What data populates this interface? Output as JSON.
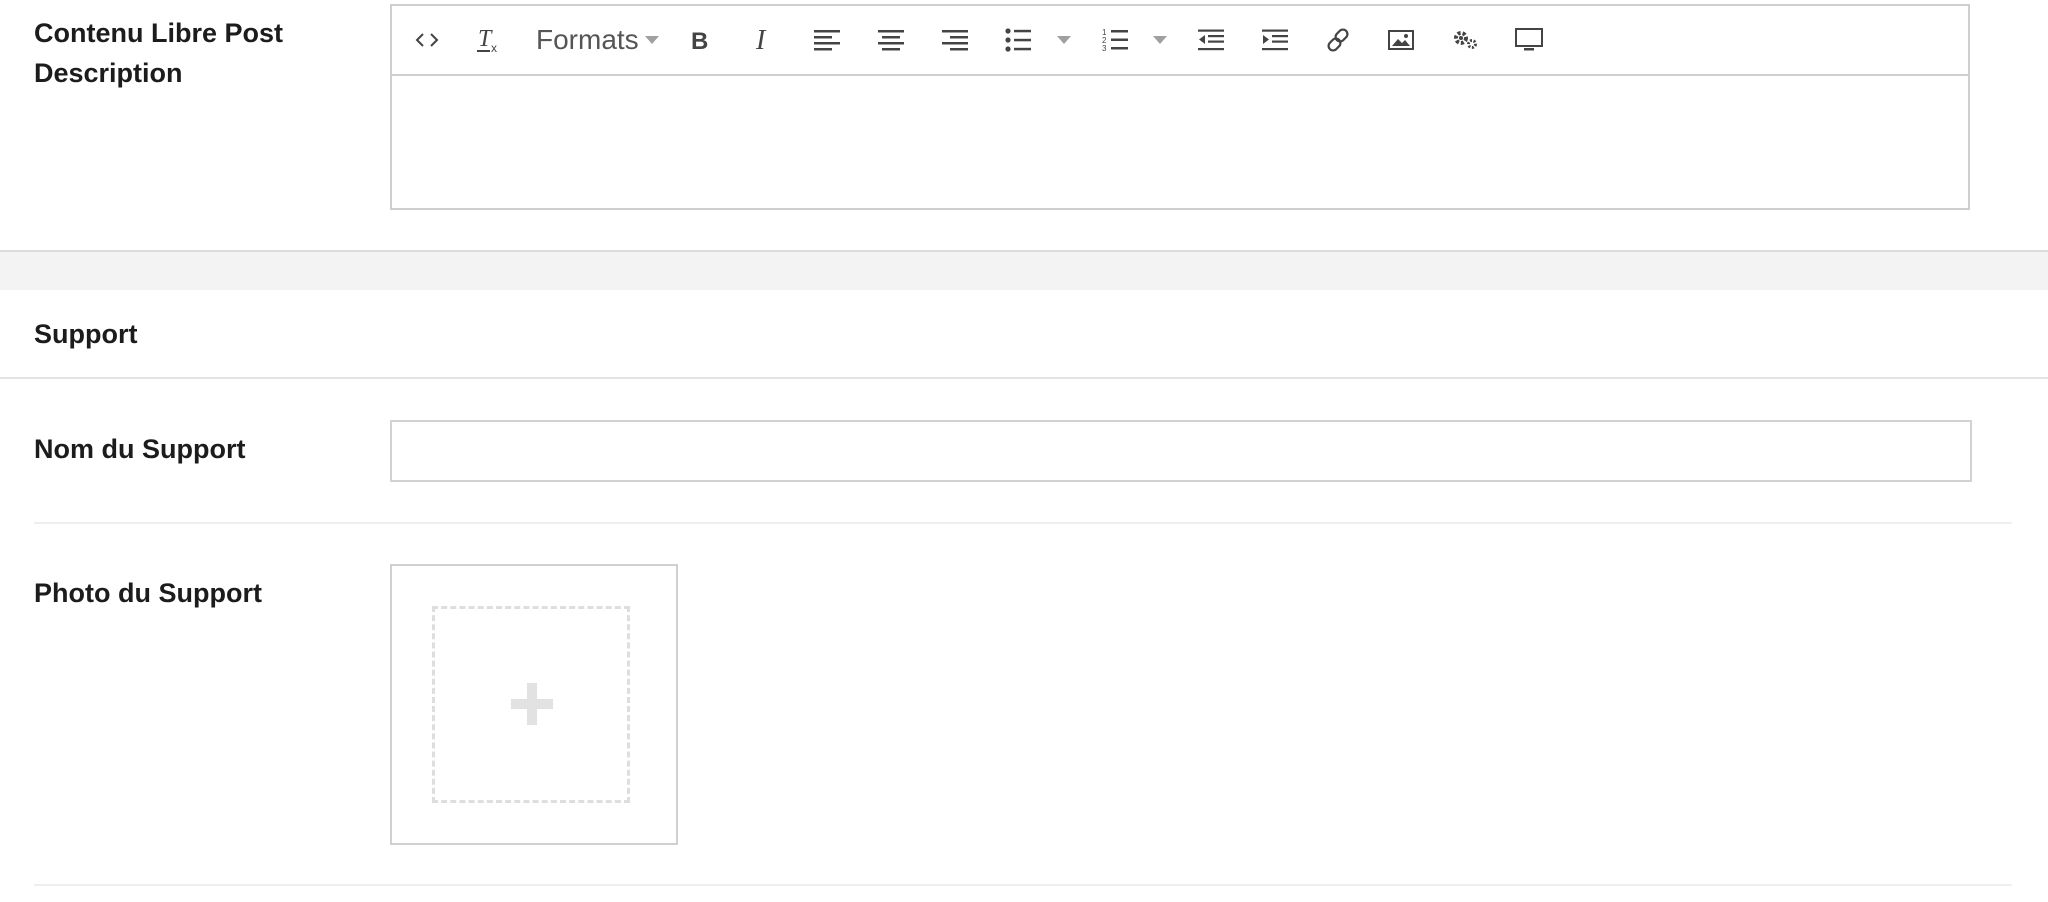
{
  "fields": {
    "contenu_label_line1": "Contenu Libre Post",
    "contenu_label_line2": "Description",
    "section_title": "Support",
    "nom_label": "Nom du Support",
    "nom_value": "",
    "photo_label": "Photo du Support"
  },
  "toolbar": {
    "formats_label": "Formats",
    "buttons": [
      "source-code-icon",
      "clear-formatting-icon",
      "formats-dropdown",
      "bold-icon",
      "italic-icon",
      "align-left-icon",
      "align-center-icon",
      "align-right-icon",
      "bullet-list-icon",
      "bullet-list-dropdown",
      "numbered-list-icon",
      "numbered-list-dropdown",
      "outdent-icon",
      "indent-icon",
      "link-icon",
      "image-icon",
      "settings-icon",
      "preview-icon"
    ]
  },
  "upload": {
    "icon": "plus-icon"
  },
  "colors": {
    "border": "#cfcfcf",
    "band": "#f4f3f4",
    "icon": "#4a4a4a"
  }
}
